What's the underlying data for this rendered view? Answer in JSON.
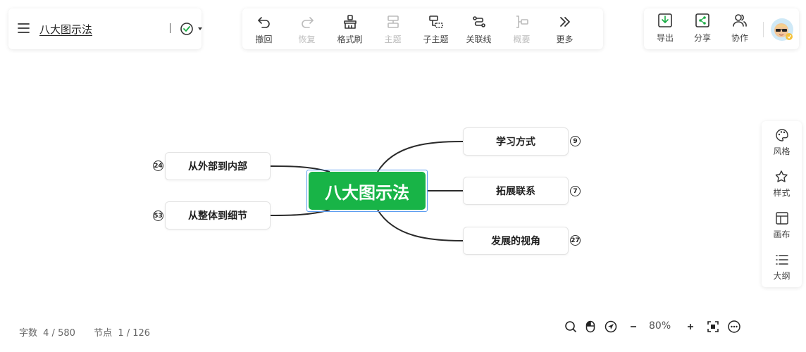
{
  "document": {
    "title": "八大图示法"
  },
  "toolbar": {
    "items": [
      {
        "label": "撤回",
        "icon": "undo-icon",
        "enabled": true
      },
      {
        "label": "恢复",
        "icon": "redo-icon",
        "enabled": false
      },
      {
        "label": "格式刷",
        "icon": "format-brush-icon",
        "enabled": true
      },
      {
        "label": "主题",
        "icon": "topic-icon",
        "enabled": false
      },
      {
        "label": "子主题",
        "icon": "subtopic-icon",
        "enabled": true
      },
      {
        "label": "关联线",
        "icon": "relation-line-icon",
        "enabled": true
      },
      {
        "label": "概要",
        "icon": "summary-icon",
        "enabled": false
      },
      {
        "label": "更多",
        "icon": "more-icon",
        "enabled": true
      }
    ]
  },
  "right_panel": {
    "items": [
      {
        "label": "导出",
        "icon": "export-icon"
      },
      {
        "label": "分享",
        "icon": "share-icon"
      },
      {
        "label": "协作",
        "icon": "collaborate-icon"
      }
    ]
  },
  "side_panel": {
    "items": [
      {
        "label": "风格",
        "icon": "palette-icon"
      },
      {
        "label": "样式",
        "icon": "style-icon"
      },
      {
        "label": "画布",
        "icon": "canvas-icon"
      },
      {
        "label": "大纲",
        "icon": "outline-icon"
      }
    ]
  },
  "mindmap": {
    "root": "八大图示法",
    "left": [
      {
        "label": "从外部到内部",
        "count": "24"
      },
      {
        "label": "从整体到细节",
        "count": "53"
      }
    ],
    "right": [
      {
        "label": "学习方式",
        "count": "9"
      },
      {
        "label": "拓展联系",
        "count": "7"
      },
      {
        "label": "发展的视角",
        "count": "27"
      }
    ]
  },
  "stats": {
    "words_label": "字数",
    "words_value": "4 / 580",
    "nodes_label": "节点",
    "nodes_value": "1 / 126"
  },
  "zoom": {
    "level": "80%"
  },
  "colors": {
    "root_fill": "#18b447",
    "export_accent": "#1aad45",
    "line": "#2a2a2a",
    "selection": "#5b9cf0"
  }
}
